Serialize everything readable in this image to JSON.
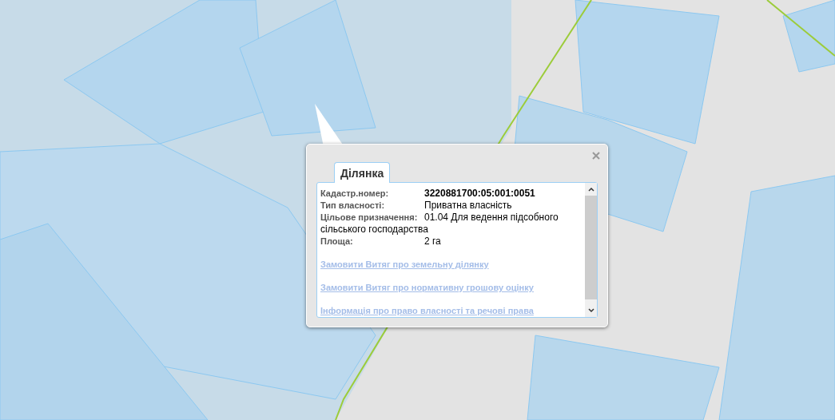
{
  "popup": {
    "tabs": [
      {
        "label": "Ділянка",
        "selected": true
      }
    ],
    "fields": [
      {
        "label": "Кадастр.номер:",
        "value": "3220881700:05:001:0051",
        "emphasis": true
      },
      {
        "label": "Тип власності:",
        "value": "Приватна власність",
        "emphasis": false
      },
      {
        "label": "Цільове призначення:",
        "value": "01.04 Для ведення підсобного",
        "value_continued": "сільського господарства",
        "emphasis": false
      },
      {
        "label": "Площа:",
        "value": "2 га",
        "emphasis": false
      }
    ],
    "links": [
      "Замовити Витяг про земельну ділянку",
      "Замовити Витяг про нормативну грошову оцінку",
      "Інформація про право власності та речові права"
    ]
  }
}
